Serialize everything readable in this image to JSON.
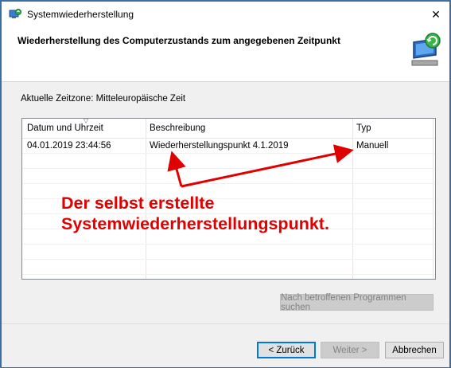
{
  "window": {
    "title": "Systemwiederherstellung",
    "close_glyph": "✕"
  },
  "header": {
    "title": "Wiederherstellung des Computerzustands zum angegebenen Zeitpunkt"
  },
  "timezone": {
    "label": "Aktuelle Zeitzone: Mitteleuropäische Zeit"
  },
  "list": {
    "columns": {
      "date": "Datum und Uhrzeit",
      "description": "Beschreibung",
      "type": "Typ"
    },
    "rows": [
      {
        "date": "04.01.2019 23:44:56",
        "description": "Wiederherstellungspunkt 4.1.2019",
        "type": "Manuell"
      }
    ]
  },
  "buttons": {
    "scan": "Nach betroffenen Programmen suchen",
    "back": "< Zurück",
    "next": "Weiter >",
    "cancel": "Abbrechen"
  },
  "annotation": {
    "line1": "Der selbst erstellte",
    "line2": "Systemwiederherstellungspunkt.",
    "color": "#e00000"
  },
  "colors": {
    "accent": "#0078d7",
    "panel": "#f0f0f0"
  }
}
